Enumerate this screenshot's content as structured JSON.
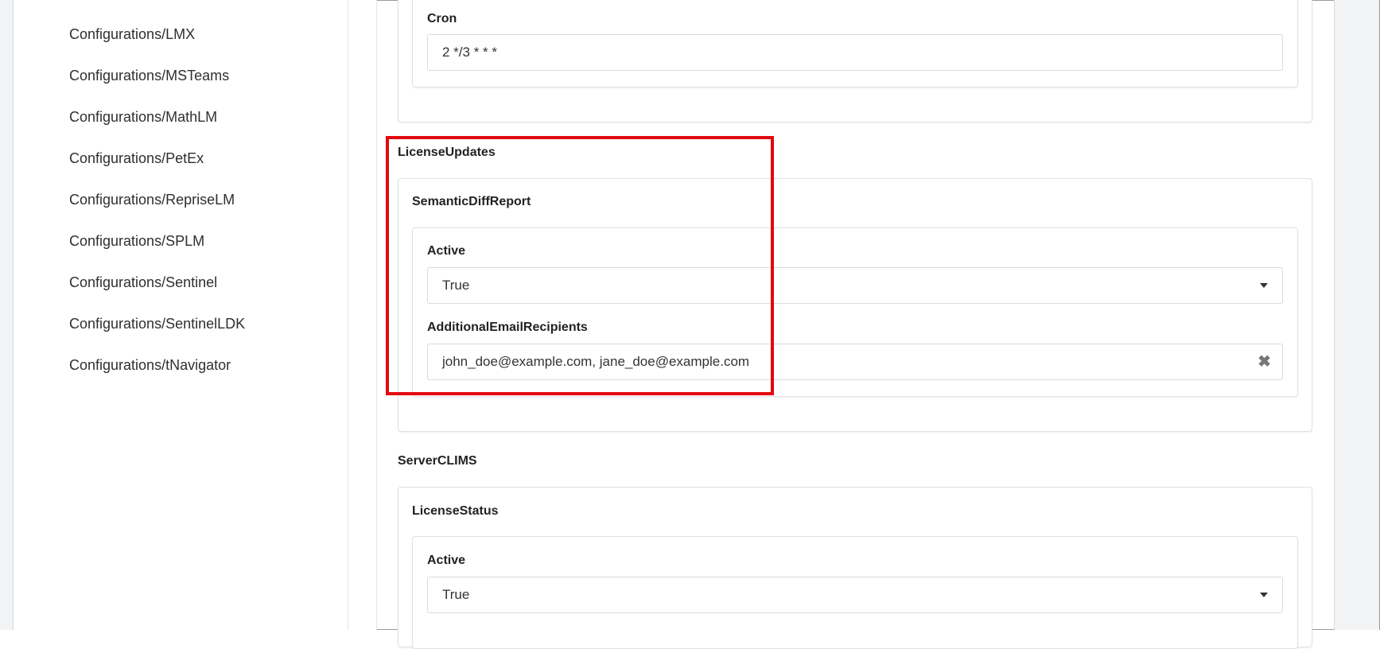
{
  "sidebar": {
    "items": [
      {
        "label": "Configurations/LMX"
      },
      {
        "label": "Configurations/MSTeams"
      },
      {
        "label": "Configurations/MathLM"
      },
      {
        "label": "Configurations/PetEx"
      },
      {
        "label": "Configurations/RepriseLM"
      },
      {
        "label": "Configurations/SPLM"
      },
      {
        "label": "Configurations/Sentinel"
      },
      {
        "label": "Configurations/SentinelLDK"
      },
      {
        "label": "Configurations/tNavigator"
      }
    ]
  },
  "cron_section": {
    "label": "Cron",
    "value": "2 */3 * * *"
  },
  "license_updates": {
    "title": "LicenseUpdates",
    "semantic_diff_report": {
      "title": "SemanticDiffReport",
      "active_label": "Active",
      "active_value": "True",
      "recipients_label": "AdditionalEmailRecipients",
      "recipients_value": "john_doe@example.com, jane_doe@example.com"
    }
  },
  "server_clims": {
    "title": "ServerCLIMS",
    "license_status": {
      "title": "LicenseStatus",
      "active_label": "Active",
      "active_value": "True"
    }
  },
  "icons": {
    "dropdown": "chevron-down-icon",
    "clear": "close-icon"
  },
  "colors": {
    "highlight": "#e3080f"
  }
}
